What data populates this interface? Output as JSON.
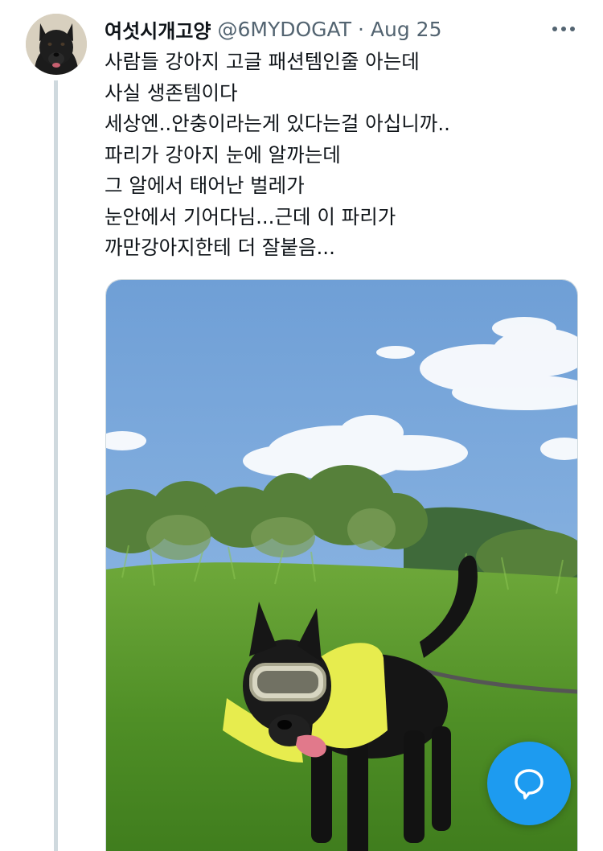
{
  "tweet": {
    "display_name": "여섯시개고양",
    "handle": "@6MYDOGAT",
    "separator": "·",
    "date": "Aug 25",
    "text_lines": [
      "사람들 강아지 고글 패션템인줄 아는데",
      "사실 생존템이다",
      "세상엔..안충이라는게 있다는걸 아십니까..",
      "파리가 강아지 눈에 알까는데",
      "그 알에서 태어난 벌레가",
      "눈안에서 기어다님...근데 이 파리가",
      "까만강아지한테 더 잘붙음..."
    ]
  },
  "icons": {
    "more": "more-horizontal-icon",
    "compose": "speech-bubble-icon"
  },
  "colors": {
    "text_primary": "#0f1419",
    "text_secondary": "#536471",
    "accent": "#1d9bf0",
    "divider": "#cfd9de"
  }
}
